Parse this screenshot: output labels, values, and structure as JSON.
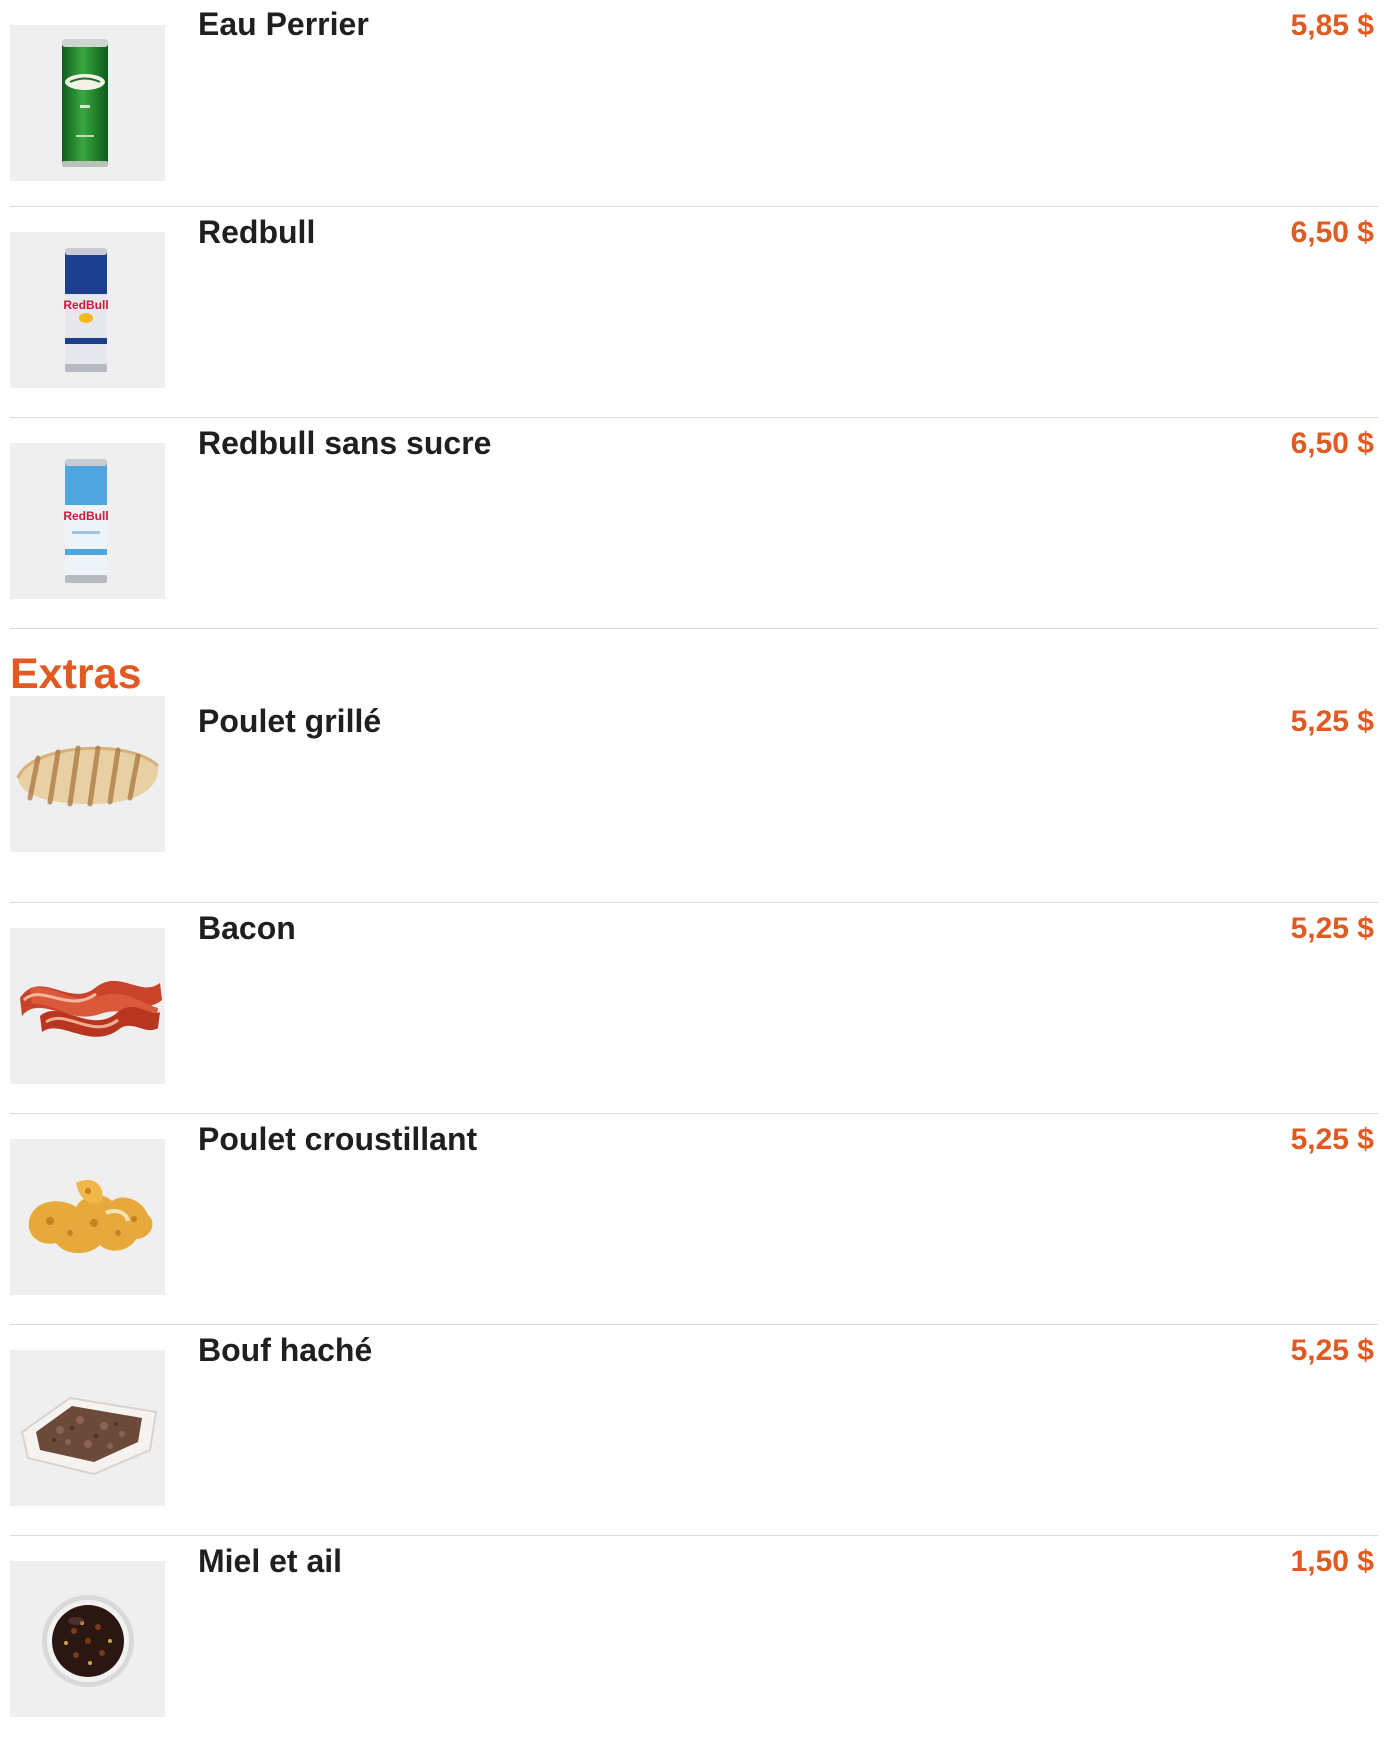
{
  "colors": {
    "accent": "#e05a22",
    "text": "#1f1f1f",
    "thumb_bg": "#efefef",
    "divider": "#dcdcdc"
  },
  "drinks": [
    {
      "name": "Eau Perrier",
      "price": "5,85 $",
      "icon": "perrier-can-icon"
    },
    {
      "name": "Redbull",
      "price": "6,50 $",
      "icon": "redbull-can-icon"
    },
    {
      "name": "Redbull sans sucre",
      "price": "6,50 $",
      "icon": "redbull-sugarfree-can-icon"
    }
  ],
  "extras": {
    "title": "Extras",
    "items": [
      {
        "name": "Poulet grillé",
        "price": "5,25 $",
        "icon": "grilled-chicken-icon"
      },
      {
        "name": "Bacon",
        "price": "5,25 $",
        "icon": "bacon-icon"
      },
      {
        "name": "Poulet croustillant",
        "price": "5,25 $",
        "icon": "crispy-chicken-icon"
      },
      {
        "name": "Bouf haché",
        "price": "5,25 $",
        "icon": "ground-beef-icon"
      },
      {
        "name": "Miel et ail",
        "price": "1,50 $",
        "icon": "honey-garlic-sauce-icon"
      }
    ]
  }
}
